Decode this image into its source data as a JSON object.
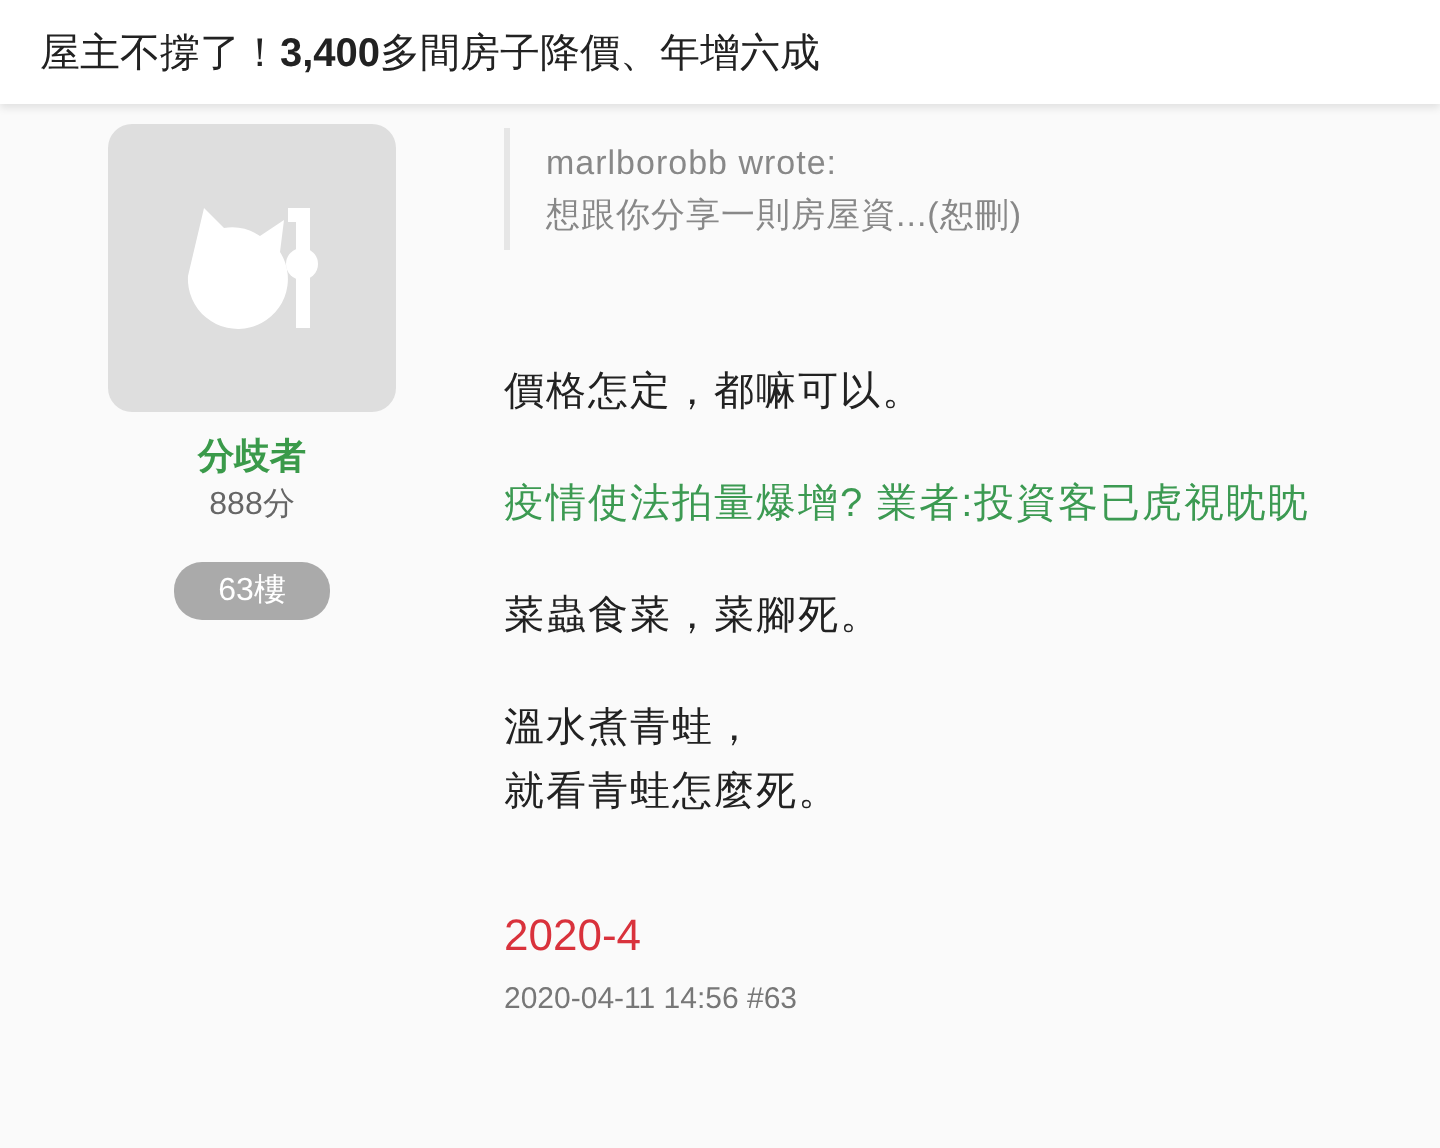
{
  "header": {
    "title": "屋主不撐了！**3,400**多間房子降價、年增六成"
  },
  "author": {
    "name": "分歧者",
    "score": "888分",
    "floor": "63樓"
  },
  "quote": {
    "author_line": "marlborobb wrote:",
    "excerpt": "想跟你分享一則房屋資...(恕刪)"
  },
  "paragraphs": [
    {
      "kind": "text",
      "lines": [
        "價格怎定，都嘛可以。"
      ]
    },
    {
      "kind": "link",
      "lines": [
        "疫情使法拍量爆增? 業者:投資客已虎視眈眈"
      ]
    },
    {
      "kind": "text",
      "lines": [
        "菜蟲食菜，菜腳死。"
      ]
    },
    {
      "kind": "text",
      "lines": [
        "溫水煮青蛙，",
        "就看青蛙怎麼死。"
      ]
    }
  ],
  "signature": "2020-4",
  "meta": "2020-04-11 14:56 #63"
}
